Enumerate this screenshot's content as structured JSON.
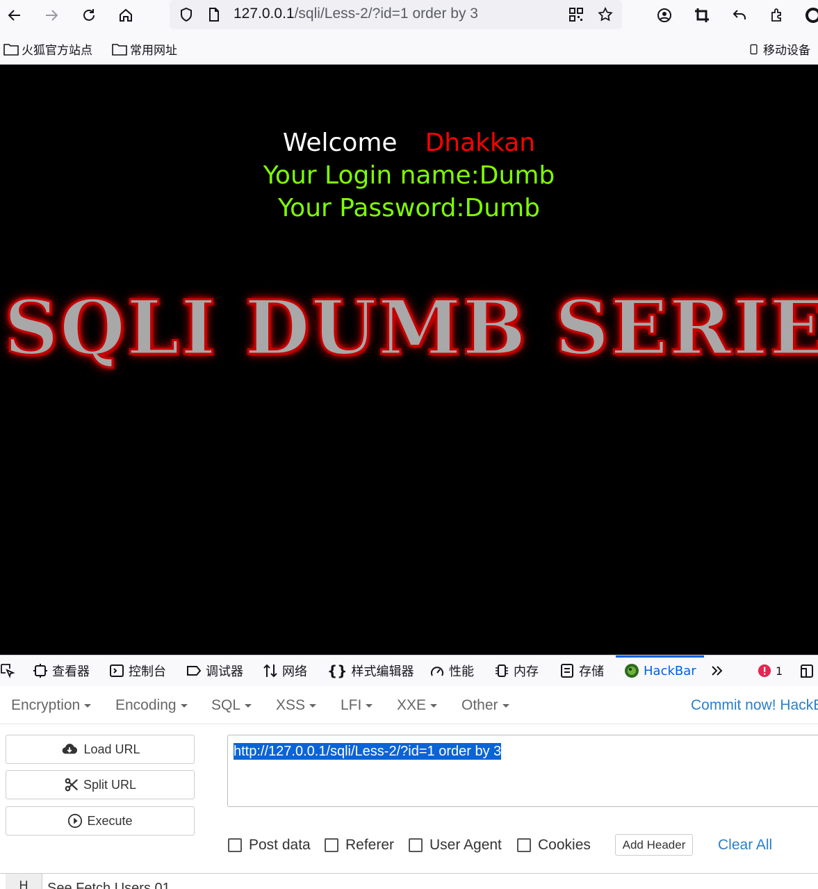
{
  "browser": {
    "url_host": "127.0.0.1",
    "url_path": "/sqli/Less-2/?id=1 order by 3",
    "bookmarks": [
      "火狐官方站点",
      "常用网址"
    ],
    "mobile_bookmark": "移动设备"
  },
  "page": {
    "welcome_word": "Welcome",
    "welcome_name": "Dhakkan",
    "login_line": "Your Login name:Dumb",
    "password_line": "Your Password:Dumb",
    "banner": "SQLI DUMB SERIES"
  },
  "devtools": {
    "tabs": [
      "查看器",
      "控制台",
      "调试器",
      "网络",
      "样式编辑器",
      "性能",
      "内存",
      "存储",
      "HackBar"
    ],
    "error_count": "1"
  },
  "hackbar": {
    "menus": [
      "Encryption",
      "Encoding",
      "SQL",
      "XSS",
      "LFI",
      "XXE",
      "Other"
    ],
    "commit_link": "Commit now! HackBar",
    "load_url": "Load URL",
    "split_url": "Split URL",
    "execute": "Execute",
    "url_value": "http://127.0.0.1/sqli/Less-2/?id=1 order by 3",
    "checkboxes": [
      "Post data",
      "Referer",
      "User Agent",
      "Cookies"
    ],
    "add_header": "Add Header",
    "clear_all": "Clear All",
    "bottom_h": "H",
    "bottom_text": "See Fetch Users 01"
  }
}
